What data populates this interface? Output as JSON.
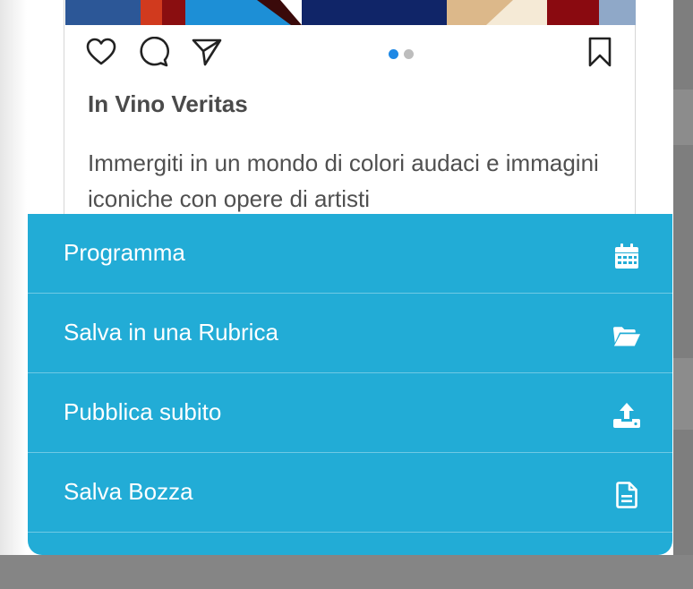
{
  "post": {
    "title": "In Vino Veritas",
    "caption": "Immergiti in un mondo di colori audaci e immagini iconiche con opere di artisti"
  },
  "actions": {
    "like_icon": "heart-icon",
    "comment_icon": "comment-icon",
    "share_icon": "send-icon",
    "bookmark_icon": "bookmark-icon",
    "carousel": {
      "count": 2,
      "active": 1
    }
  },
  "sheet": {
    "items": [
      {
        "label": "Programma",
        "icon": "calendar-icon"
      },
      {
        "label": "Salva in una Rubrica",
        "icon": "folder-open-icon"
      },
      {
        "label": "Pubblica subito",
        "icon": "upload-icon"
      },
      {
        "label": "Salva Bozza",
        "icon": "document-icon"
      }
    ]
  },
  "colors": {
    "sheet_background": "#22acd6",
    "carousel_active": "#1e88e5",
    "carousel_inactive": "#bdbdbd",
    "text_dark": "#4a4a4a"
  }
}
